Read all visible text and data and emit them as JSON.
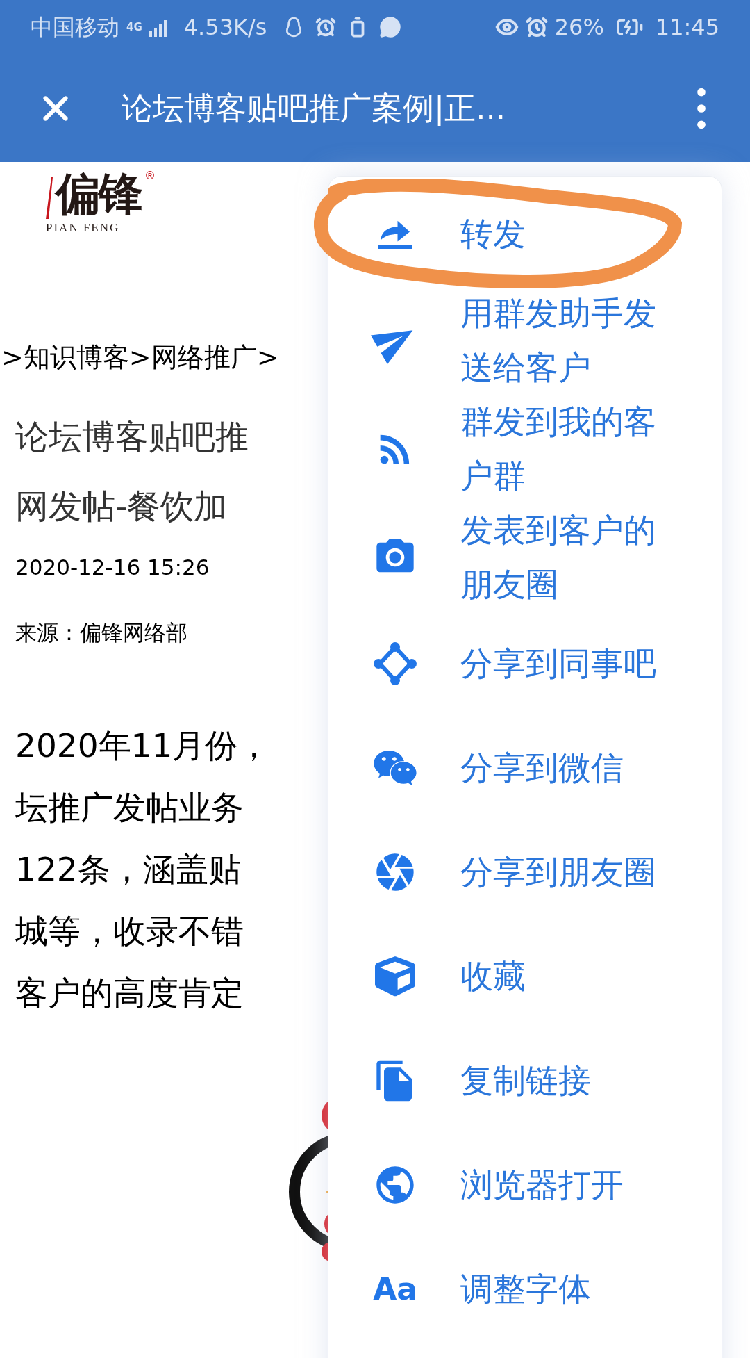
{
  "status_bar": {
    "carrier": "中国移动",
    "network": "4G",
    "speed": "4.53K/s",
    "battery": "26%",
    "time": "11:45"
  },
  "header": {
    "title": "论坛博客贴吧推广案例|正..."
  },
  "article": {
    "logo": {
      "name": "偏锋",
      "latin": "PIAN FENG",
      "mark": "®"
    },
    "breadcrumb": ">知识博客>网络推广>",
    "title_lines": [
      "论坛博客贴吧推",
      "网发帖-餐饮加"
    ],
    "date": "2020-12-16 15:26",
    "source": "来源：偏锋网络部",
    "body_lines": [
      "2020年11月份，",
      "坛推广发帖业务",
      "122条，涵盖贴",
      "城等，收录不错",
      "客户的高度肯定"
    ]
  },
  "menu": {
    "items": [
      {
        "kind": "forward",
        "label": "转发"
      },
      {
        "kind": "send",
        "label": "用群发助手发送给客户"
      },
      {
        "kind": "feed",
        "label": "群发到我的客户群"
      },
      {
        "kind": "camera",
        "label": "发表到客户的朋友圈"
      },
      {
        "kind": "nodes",
        "label": "分享到同事吧"
      },
      {
        "kind": "chat",
        "label": "分享到微信"
      },
      {
        "kind": "aperture",
        "label": "分享到朋友圈"
      },
      {
        "kind": "cube",
        "label": "收藏"
      },
      {
        "kind": "copy",
        "label": "复制链接"
      },
      {
        "kind": "globe",
        "label": "浏览器打开"
      },
      {
        "kind": "font",
        "icon_text": "Aa",
        "label": "调整字体"
      }
    ]
  }
}
